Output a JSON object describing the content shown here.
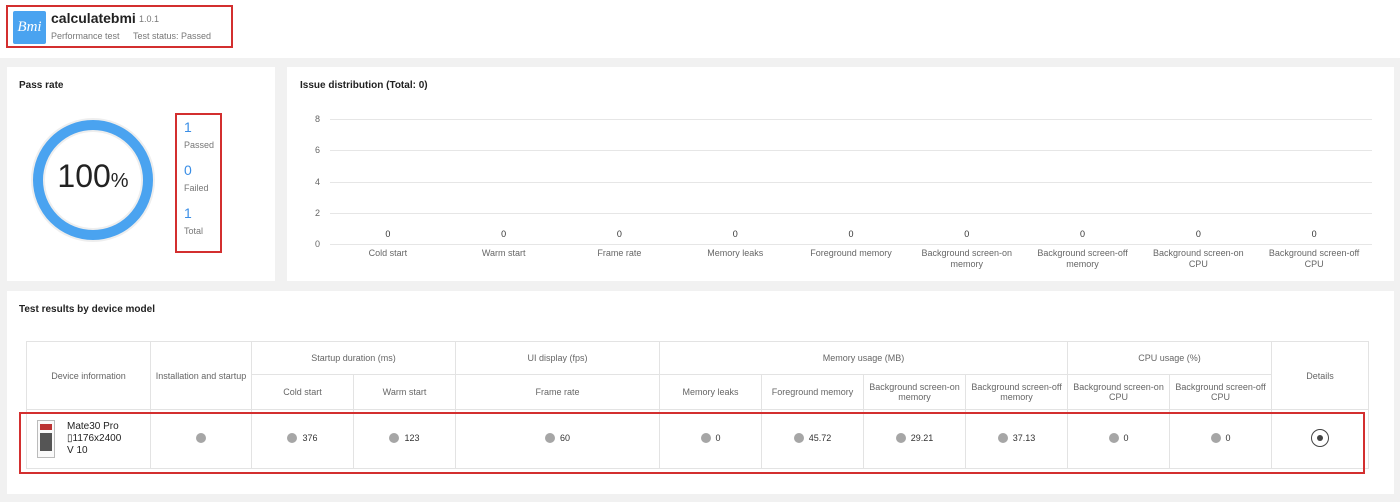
{
  "header": {
    "icon_text": "Bmi",
    "app_name": "calculatebmi",
    "version": "1.0.1",
    "test_type": "Performance test",
    "test_status": "Test status: Passed"
  },
  "pass_rate": {
    "title": "Pass rate",
    "percent_value": "100",
    "percent_symbol": "%",
    "passed_count": "1",
    "passed_label": "Passed",
    "failed_count": "0",
    "failed_label": "Failed",
    "total_count": "1",
    "total_label": "Total",
    "fraction": 1.0,
    "colors": {
      "ring": "#4aa3f0",
      "track": "#eeeeee"
    }
  },
  "issue_distribution": {
    "title": "Issue distribution (Total: 0)"
  },
  "chart_data": {
    "type": "bar",
    "title": "Issue distribution (Total: 0)",
    "categories": [
      "Cold start",
      "Warm start",
      "Frame rate",
      "Memory leaks",
      "Foreground memory",
      "Background screen-on memory",
      "Background screen-off memory",
      "Background screen-on CPU",
      "Background screen-off CPU"
    ],
    "values": [
      0,
      0,
      0,
      0,
      0,
      0,
      0,
      0,
      0
    ],
    "yticks": [
      "0",
      "2",
      "4",
      "6",
      "8"
    ],
    "ylim": [
      0,
      8
    ],
    "grid": true
  },
  "results": {
    "title": "Test results by device model",
    "headers": {
      "device_info": "Device information",
      "install": "Installation and startup",
      "startup_group": "Startup duration (ms)",
      "ui_group": "UI display (fps)",
      "memory_group": "Memory usage (MB)",
      "cpu_group": "CPU usage (%)",
      "details": "Details",
      "cold_start": "Cold start",
      "warm_start": "Warm start",
      "frame_rate": "Frame rate",
      "memory_leaks": "Memory leaks",
      "foreground_memory": "Foreground memory",
      "bg_on_memory": "Background screen-on memory",
      "bg_off_memory": "Background screen-off memory",
      "bg_on_cpu": "Background screen-on CPU",
      "bg_off_cpu": "Background screen-off CPU"
    },
    "row": {
      "device_name": "Mate30 Pro",
      "resolution": "1176x2400",
      "os_version": "V 10",
      "cold_start": "376",
      "warm_start": "123",
      "frame_rate": "60",
      "memory_leaks": "0",
      "foreground_memory": "45.72",
      "bg_on_memory": "29.21",
      "bg_off_memory": "37.13",
      "bg_on_cpu": "0",
      "bg_off_cpu": "0"
    }
  }
}
